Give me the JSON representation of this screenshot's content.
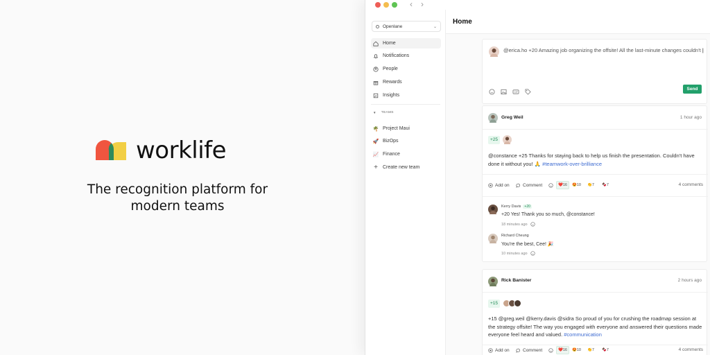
{
  "brand": {
    "name": "worklife",
    "tagline": "The recognition platform for modern teams",
    "colors": {
      "red": "#f0553f",
      "yellow": "#f2cf45",
      "overlap": "#2e8a5c"
    }
  },
  "window": {
    "back_icon": "chevron-left-icon",
    "forward_icon": "chevron-right-icon"
  },
  "sidebar": {
    "org": "Openlane",
    "items": [
      {
        "label": "Home",
        "icon": "home-icon",
        "active": true
      },
      {
        "label": "Notifications",
        "icon": "bell-icon"
      },
      {
        "label": "People",
        "icon": "user-circle-icon"
      },
      {
        "label": "Rewards",
        "icon": "gift-icon"
      },
      {
        "label": "Insights",
        "icon": "chart-icon"
      }
    ],
    "teams_heading": "TEAMS",
    "teams": [
      {
        "label": "Project Maui",
        "emoji": "🌴"
      },
      {
        "label": "BizOps",
        "emoji": "🚀"
      },
      {
        "label": "Finance",
        "emoji": "📈"
      }
    ],
    "create_team": "Create new team"
  },
  "main": {
    "title": "Home",
    "composer": {
      "mention": "@erica.ho",
      "points": "+20",
      "text": "Amazing job organizing the offsite! All the last-minute changes couldn't",
      "caret": "|",
      "send": "Send"
    },
    "posts": [
      {
        "author": "Greg Weil",
        "time": "1 hour ago",
        "points": "+25",
        "body": "@constance +25 Thanks for staying back to help us finish the presentation. Couldn't have done it without you! 🙏",
        "tag": "#teamwork-over-brilliance",
        "add_on": "Add on",
        "comment": "Comment",
        "reactions": [
          {
            "emoji": "❤️",
            "count": "16"
          },
          {
            "emoji": "😍",
            "count": "10"
          },
          {
            "emoji": "👏",
            "count": "7"
          },
          {
            "emoji": "🍫",
            "count": "7"
          }
        ],
        "comments_count": "4 comments",
        "comments": [
          {
            "author": "Kerry Davis",
            "badge": "+20",
            "text": "+20 Yes! Thank you so much, @constance!",
            "time": "18 minutes ago"
          },
          {
            "author": "Richard Cheung",
            "badge": "",
            "text": "You're the best, Cee! 🎉",
            "time": "10 minutes ago"
          }
        ]
      },
      {
        "author": "Rick Banister",
        "time": "2 hours ago",
        "points": "+15",
        "body": "+15 @greg.weil @kerry.davis @sidra So proud of you for crushing the roadmap session at the strategy offsite! The way you engaged with everyone and answered their questions made everyone feel heard and valued.",
        "tag": "#communication",
        "add_on": "Add on",
        "comment": "Comment",
        "reactions": [
          {
            "emoji": "❤️",
            "count": "16"
          },
          {
            "emoji": "😍",
            "count": "10"
          },
          {
            "emoji": "👏",
            "count": "7"
          },
          {
            "emoji": "🍫",
            "count": "7"
          }
        ],
        "comments_count": "4 comments"
      }
    ]
  }
}
